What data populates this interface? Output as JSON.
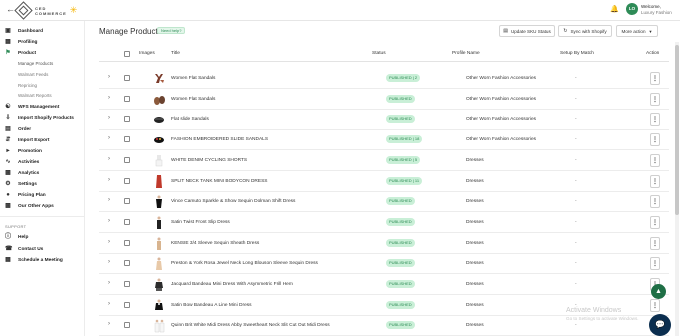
{
  "topbar": {
    "logo_line1": "CED",
    "logo_line2": "COMMERCE",
    "welcome": "Welcome,",
    "user": "Luxury Fashion",
    "avatar": "LO"
  },
  "sidebar": {
    "items": [
      {
        "label": "Dashboard",
        "icon": "dashboard-icon"
      },
      {
        "label": "Profiling",
        "icon": "profiling-icon"
      },
      {
        "label": "Product",
        "icon": "product-icon"
      }
    ],
    "subitems": [
      "Manage Products",
      "Walmart Feeds",
      "Repricing",
      "Walmart Reports"
    ],
    "items2": [
      {
        "label": "WFS Management",
        "icon": "wfs-icon"
      },
      {
        "label": "Import Shopify Products",
        "icon": "import-icon"
      },
      {
        "label": "Order",
        "icon": "order-icon"
      },
      {
        "label": "Import Export",
        "icon": "import-export-icon"
      },
      {
        "label": "Promotion",
        "icon": "promotion-icon"
      },
      {
        "label": "Activities",
        "icon": "activities-icon"
      },
      {
        "label": "Analytics",
        "icon": "analytics-icon"
      },
      {
        "label": "Settings",
        "icon": "settings-icon"
      },
      {
        "label": "Pricing Plan",
        "icon": "pricing-icon"
      },
      {
        "label": "Our Other Apps",
        "icon": "apps-icon"
      }
    ],
    "support_label": "SUPPORT",
    "support": [
      {
        "label": "Help",
        "icon": "help-icon"
      },
      {
        "label": "Contact Us",
        "icon": "contact-icon"
      },
      {
        "label": "Schedule a Meeting",
        "icon": "calendar-icon"
      }
    ]
  },
  "header": {
    "title": "Manage Products",
    "need_help": "Need help?",
    "update_sku": "Update SKU Status",
    "sync_shopify": "Sync with Shopify",
    "more_action": "More action"
  },
  "table": {
    "columns": {
      "images": "Images",
      "title": "Title",
      "status": "Status",
      "profile": "Profile Name",
      "setup": "Setup By Match",
      "action": "Action"
    },
    "rows": [
      {
        "title": "Women Flat Sandals",
        "status": "PUBLISHED | 2",
        "profile": "Other Worn Fashion Accessories",
        "setup": "-"
      },
      {
        "title": "Women Flat Sandals",
        "status": "PUBLISHED",
        "profile": "Other Worn Fashion Accessories",
        "setup": "-"
      },
      {
        "title": "Flat slide Sandals",
        "status": "PUBLISHED",
        "profile": "Other Worn Fashion Accessories",
        "setup": "-"
      },
      {
        "title": "FASHION EMBROIDERED SLIDE SANDALS",
        "status": "PUBLISHED | 18",
        "profile": "Other Worn Fashion Accessories",
        "setup": "-"
      },
      {
        "title": "WHITE DENIM CYCLING SHORTS",
        "status": "PUBLISHED | 5",
        "profile": "Dresses",
        "setup": "-"
      },
      {
        "title": "SPLIT NECK TANK MINI BODYCON DRESS",
        "status": "PUBLISHED | 11",
        "profile": "Dresses",
        "setup": "-"
      },
      {
        "title": "Vince Camuto Sparkle & Show Sequin Dolman Shift Dress",
        "status": "PUBLISHED",
        "profile": "Dresses",
        "setup": "-"
      },
      {
        "title": "Satin Twist Front Slip Dress",
        "status": "PUBLISHED",
        "profile": "Dresses",
        "setup": "-"
      },
      {
        "title": "KENSIE 3/4 Sleeve Sequin Sheath Dress",
        "status": "PUBLISHED",
        "profile": "Dresses",
        "setup": "-"
      },
      {
        "title": "Preston & York Rosa Jewel Neck Long Blouson Sleeve Sequin Dress",
        "status": "PUBLISHED",
        "profile": "Dresses",
        "setup": "-"
      },
      {
        "title": "Jacquard Bandeau Mini Dress With Asymmetric Frill Hem",
        "status": "PUBLISHED",
        "profile": "Dresses",
        "setup": "-"
      },
      {
        "title": "Satin Bow Bandeau A Line Mini Dress",
        "status": "PUBLISHED",
        "profile": "Dresses",
        "setup": "-"
      },
      {
        "title": "Quinn Brit White Midi Dress Abby Sweetheart Neck Slit Cut Out Midi Dress",
        "status": "PUBLISHED",
        "profile": "Dresses",
        "setup": "-"
      }
    ]
  },
  "watermark": {
    "line1": "Activate Windows",
    "line2": "Go to Settings to activate Windows."
  },
  "colors": {
    "accent": "#2e8b57",
    "status_bg": "#c9efd7",
    "status_text": "#2a8a52",
    "chat": "#0b2e4f"
  }
}
